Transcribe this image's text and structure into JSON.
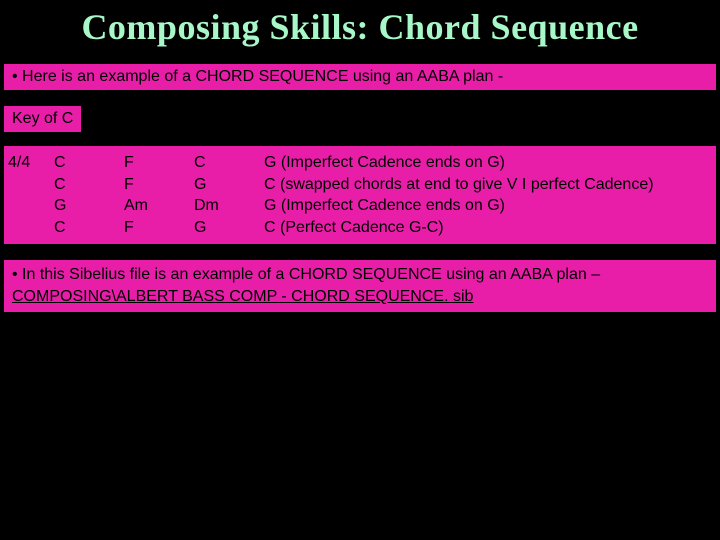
{
  "title": "Composing Skills: Chord Sequence",
  "bullet1_prefix": " • ",
  "bullet1_text": "Here is an example of a CHORD SEQUENCE using an AABA plan -",
  "key_label": "Key of C",
  "time_sig": "4/4",
  "row0": {
    "c0": "C",
    "c1": "F",
    "c2": "C",
    "c3": "G (Imperfect Cadence ends on G)"
  },
  "row1": {
    "c0": "C",
    "c1": "F",
    "c2": "G",
    "c3": "C (swapped chords at end to give V I perfect Cadence)"
  },
  "row2": {
    "c0": "G",
    "c1": "Am",
    "c2": "Dm",
    "c3": "G (Imperfect Cadence ends on G)"
  },
  "row3": {
    "c0": "C",
    "c1": "F",
    "c2": "G",
    "c3": "C (Perfect Cadence G-C)"
  },
  "bullet2_prefix": " • ",
  "bullet2_text": "In this Sibelius file is an example of a CHORD SEQUENCE using an AABA plan – ",
  "link_text": "COMPOSING\\ALBERT BASS COMP - CHORD SEQUENCE. sib"
}
